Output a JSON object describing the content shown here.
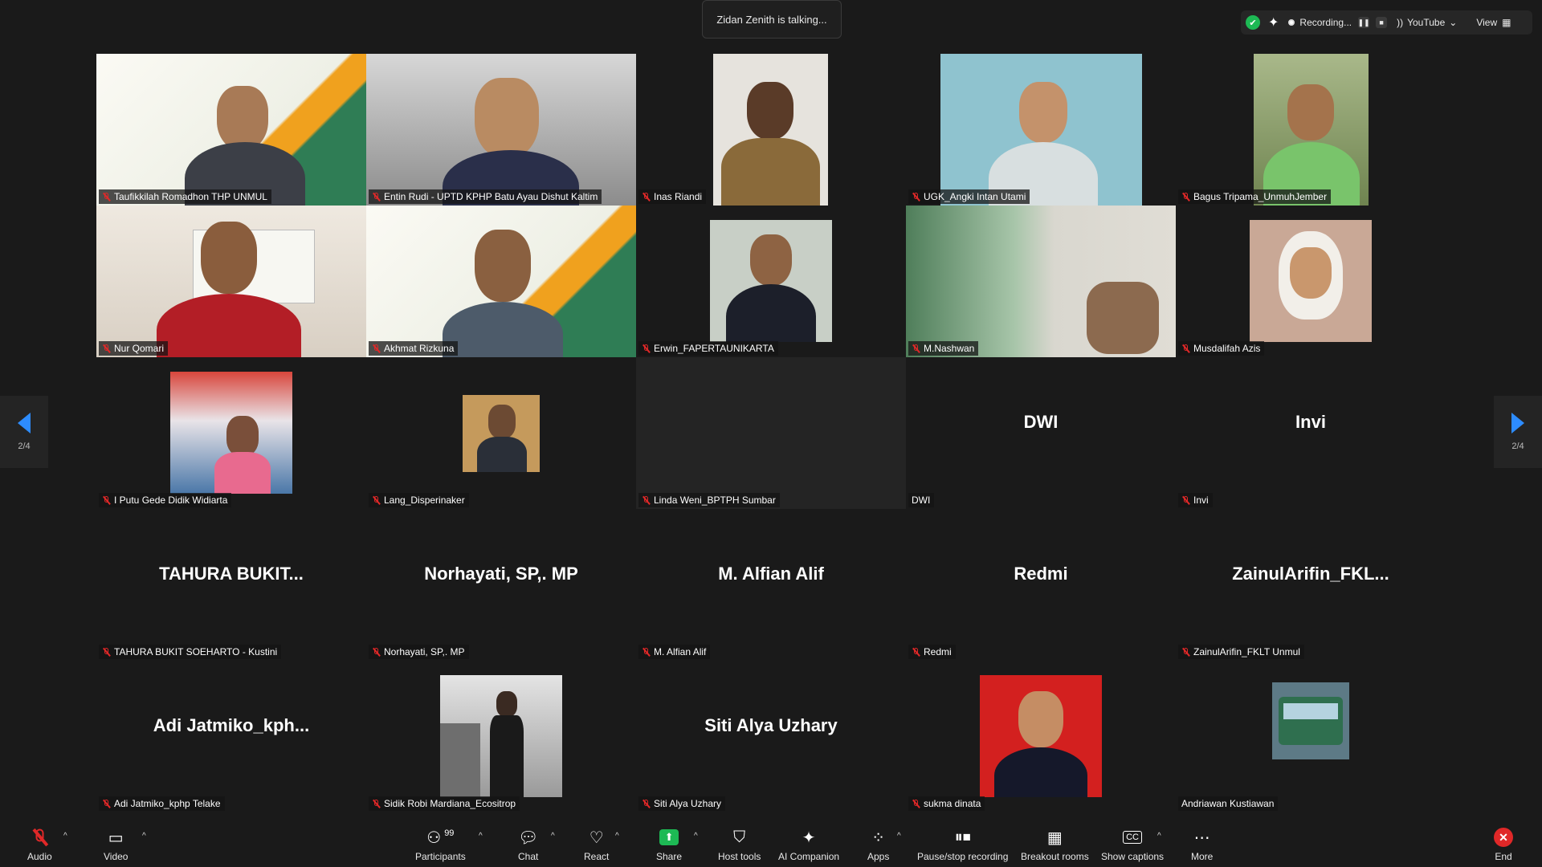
{
  "talking_toast": "Zidan Zenith is talking...",
  "status_bar": {
    "recording_label": "Recording...",
    "stream_label": "YouTube",
    "view_label": "View"
  },
  "pagination": {
    "left": "2/4",
    "right": "2/4"
  },
  "tiles": [
    {
      "name": "Taufikkilah Romadhon THP UNMUL",
      "video": true
    },
    {
      "name": "Entin Rudi - UPTD KPHP Batu Ayau Dishut Kaltim",
      "video": true
    },
    {
      "name": "Inas Riandi",
      "video": true
    },
    {
      "name": "UGK_Angki Intan Utami",
      "video": true
    },
    {
      "name": "Bagus Tripama_UnmuhJember",
      "video": true
    },
    {
      "name": "Nur Qomari",
      "video": true
    },
    {
      "name": "Akhmat Rizkuna",
      "video": true
    },
    {
      "name": "Erwin_FAPERTAUNIKARTA",
      "video": true
    },
    {
      "name": "M.Nashwan",
      "video": true
    },
    {
      "name": "Musdalifah Azis",
      "video": true
    },
    {
      "name": "I Putu Gede Didik Widiarta",
      "video": true
    },
    {
      "name": "Lang_Disperinaker",
      "video": true
    },
    {
      "name": "Linda Weni_BPTPH Sumbar",
      "video": false
    },
    {
      "name": "DWI",
      "display": "DWI",
      "video": false
    },
    {
      "name": "Invi",
      "display": "Invi",
      "video": false
    },
    {
      "name": "TAHURA BUKIT SOEHARTO - Kustini",
      "display": "TAHURA  BUKIT...",
      "video": false
    },
    {
      "name": "Norhayati, SP,. MP",
      "display": "Norhayati, SP,. MP",
      "video": false
    },
    {
      "name": "M. Alfian Alif",
      "display": "M. Alfian Alif",
      "video": false
    },
    {
      "name": "Redmi",
      "display": "Redmi",
      "video": false
    },
    {
      "name": "ZainulArifin_FKLT Unmul",
      "display": "ZainulArifin_FKL...",
      "video": false
    },
    {
      "name": "Adi Jatmiko_kphp Telake",
      "display": "Adi  Jatmiko_kph...",
      "video": false
    },
    {
      "name": "Sidik Robi Mardiana_Ecositrop",
      "video": true
    },
    {
      "name": "Siti Alya Uzhary",
      "display": "Siti Alya Uzhary",
      "video": false
    },
    {
      "name": "sukma dinata",
      "video": true
    },
    {
      "name": "Andriawan Kustiawan",
      "video": true
    }
  ],
  "toolbar": {
    "audio": "Audio",
    "video": "Video",
    "participants": "Participants",
    "participants_count": "99",
    "chat": "Chat",
    "react": "React",
    "share": "Share",
    "host_tools": "Host tools",
    "ai_companion": "AI Companion",
    "apps": "Apps",
    "pause_recording": "Pause/stop recording",
    "breakout_rooms": "Breakout rooms",
    "show_captions": "Show captions",
    "more": "More",
    "end": "End"
  },
  "colors": {
    "accent": "#2d8cff",
    "share": "#1db954",
    "end": "#e02828",
    "background": "#1a1a1a"
  }
}
